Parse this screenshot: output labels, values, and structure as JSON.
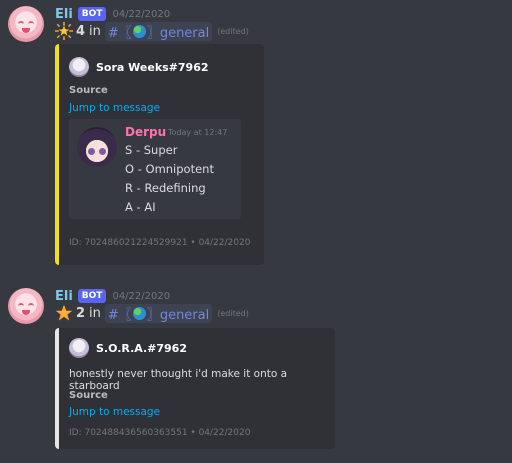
{
  "messages": [
    {
      "author": "Eli",
      "bot_tag": "BOT",
      "timestamp": "04/22/2020",
      "star_count": "4",
      "in_text": "in",
      "channel_prefix": "#〖",
      "channel_suffix": "〗general",
      "edited": "(edited)",
      "embed": {
        "author": "Sora Weeks#7962",
        "source_label": "Source",
        "jump_label": "Jump to message",
        "image": {
          "author": "Derpu",
          "time": "Today at 12:47",
          "lines": [
            "S - Super",
            "O - Omnipotent",
            "R - Redefining",
            "A - AI"
          ]
        },
        "footer": "ID: 702486021224529921 • 04/22/2020",
        "accent_color": "#f1e01a"
      }
    },
    {
      "author": "Eli",
      "bot_tag": "BOT",
      "timestamp": "04/22/2020",
      "star_count": "2",
      "in_text": "in",
      "channel_prefix": "#〖",
      "channel_suffix": "〗general",
      "edited": "(edited)",
      "embed": {
        "author": "S.O.R.A.#7962",
        "text": "honestly never thought i'd make it onto a starboard",
        "source_label": "Source",
        "jump_label": "Jump to message",
        "footer": "ID: 702488436560363551 • 04/22/2020",
        "accent_color": "#e3e5e8"
      }
    }
  ]
}
